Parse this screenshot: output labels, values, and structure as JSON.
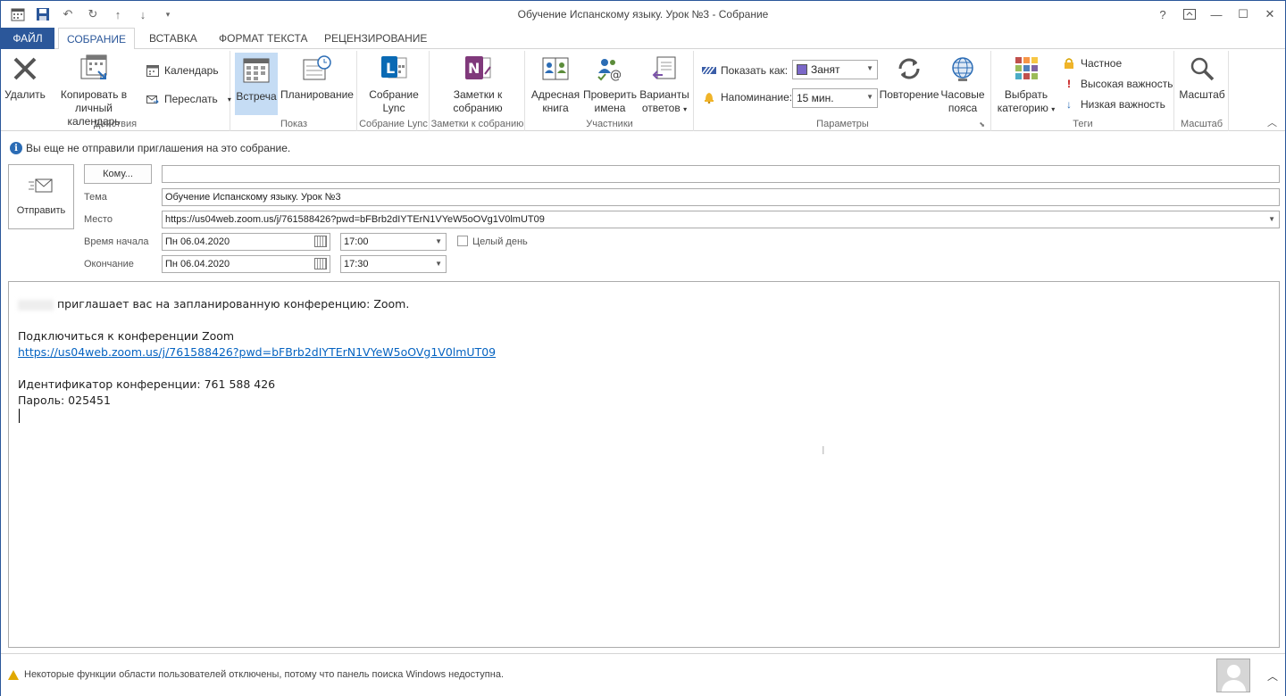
{
  "window": {
    "title": "Обучение Испанскому языку. Урок №3 - Собрание",
    "controls": {
      "help": "?",
      "minimize": "—",
      "maximize": "☐",
      "close": "✕"
    }
  },
  "tabs": [
    "ФАЙЛ",
    "СОБРАНИЕ",
    "ВСТАВКА",
    "ФОРМАТ ТЕКСТА",
    "РЕЦЕНЗИРОВАНИЕ"
  ],
  "ribbon": {
    "actions": {
      "delete": "Удалить",
      "copy_line1": "Копировать в",
      "copy_line2": "личный календарь",
      "calendar": "Календарь",
      "forward": "Переслать",
      "group": "Действия"
    },
    "show": {
      "meeting": "Встреча",
      "scheduling": "Планирование",
      "group": "Показ"
    },
    "lync": {
      "line1": "Собрание",
      "line2": "Lync",
      "group": "Собрание Lync"
    },
    "notes": {
      "line1": "Заметки к",
      "line2": "собранию",
      "group": "Заметки к собранию"
    },
    "attendees": {
      "address_line1": "Адресная",
      "address_line2": "книга",
      "check_line1": "Проверить",
      "check_line2": "имена",
      "response_line1": "Варианты",
      "response_line2": "ответов",
      "group": "Участники"
    },
    "options": {
      "show_as_label": "Показать как:",
      "show_as_value": "Занят",
      "reminder_label": "Напоминание:",
      "reminder_value": "15 мин.",
      "recurrence": "Повторение",
      "tz_line1": "Часовые",
      "tz_line2": "пояса",
      "group": "Параметры"
    },
    "tags": {
      "cat_line1": "Выбрать",
      "cat_line2": "категорию",
      "private": "Частное",
      "high": "Высокая важность",
      "low": "Низкая важность",
      "group": "Теги"
    },
    "zoom": {
      "label": "Масштаб",
      "group": "Масштаб"
    }
  },
  "info": "Вы еще не отправили приглашения на это собрание.",
  "form": {
    "send": "Отправить",
    "to_button": "Кому...",
    "to_value": "",
    "subject_label": "Тема",
    "subject_value": "Обучение Испанскому языку. Урок №3",
    "location_label": "Место",
    "location_value": "https://us04web.zoom.us/j/761588426?pwd=bFBrb2dIYTErN1VYeW5oOVg1V0lmUT09",
    "start_label": "Время начала",
    "start_date": "Пн 06.04.2020",
    "start_time": "17:00",
    "allday_label": "Целый день",
    "end_label": "Окончание",
    "end_date": "Пн 06.04.2020",
    "end_time": "17:30"
  },
  "body": {
    "line1": "приглашает вас на запланированную конференцию: Zoom.",
    "line2": "Подключиться к конференции Zoom",
    "link": "https://us04web.zoom.us/j/761588426?pwd=bFBrb2dIYTErN1VYeW5oOVg1V0lmUT09",
    "line3": "Идентификатор конференции: 761 588 426",
    "line4": "Пароль: 025451"
  },
  "status": {
    "message": "Некоторые функции области пользователей отключены, потому что панель поиска Windows недоступна."
  },
  "colors": {
    "accent": "#2b579a",
    "link": "#0563c1",
    "selected": "#c5dcf4"
  }
}
